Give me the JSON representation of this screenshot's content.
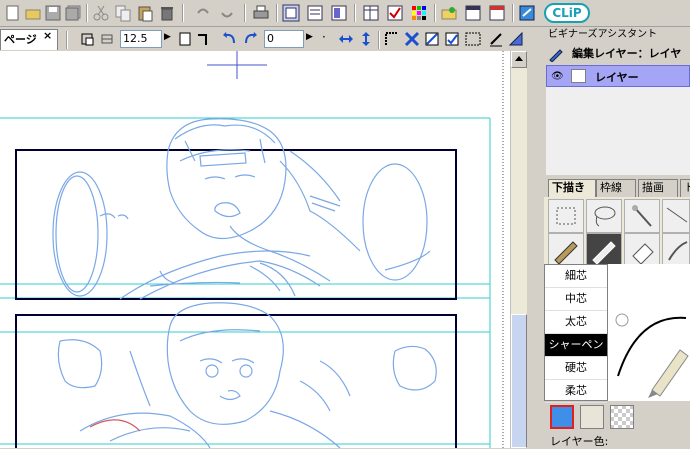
{
  "toolbar": {
    "icons": [
      "new-file-icon",
      "open-icon",
      "save-icon",
      "save-all-icon",
      "cut-icon",
      "copy-icon",
      "paste-icon",
      "delete-icon",
      "undo-icon",
      "redo-icon",
      "print-icon",
      "page-view-icon",
      "story-view-icon",
      "layer-view-icon",
      "grid-view-icon",
      "check-icon",
      "color-grid-icon",
      "folder-icon",
      "window-icon",
      "window-alt-icon",
      "clip-icon"
    ],
    "clip_label": "CLiP"
  },
  "doc_tab": {
    "label": "ページ",
    "close": "×"
  },
  "row2": {
    "brush_size": "12.5",
    "rotation": "0"
  },
  "panel": {
    "title": "ビギナーズアシスタント",
    "edit_layer_label": "編集レイヤー：レイヤ",
    "layer_name": "レイヤー",
    "tabs": [
      "下描き",
      "枠線",
      "描画",
      "ト"
    ],
    "brushes": [
      "細芯",
      "中芯",
      "太芯",
      "シャーペン",
      "硬芯",
      "柔芯"
    ],
    "active_brush_index": 3,
    "layer_color_label": "レイヤー色:"
  },
  "colors": {
    "guide": "#33cccc",
    "frame": "#000033",
    "sketch": "#7aa8e6",
    "layer_highlight": "#a5a5f5",
    "swatch_blue": "#3f8fe8"
  }
}
